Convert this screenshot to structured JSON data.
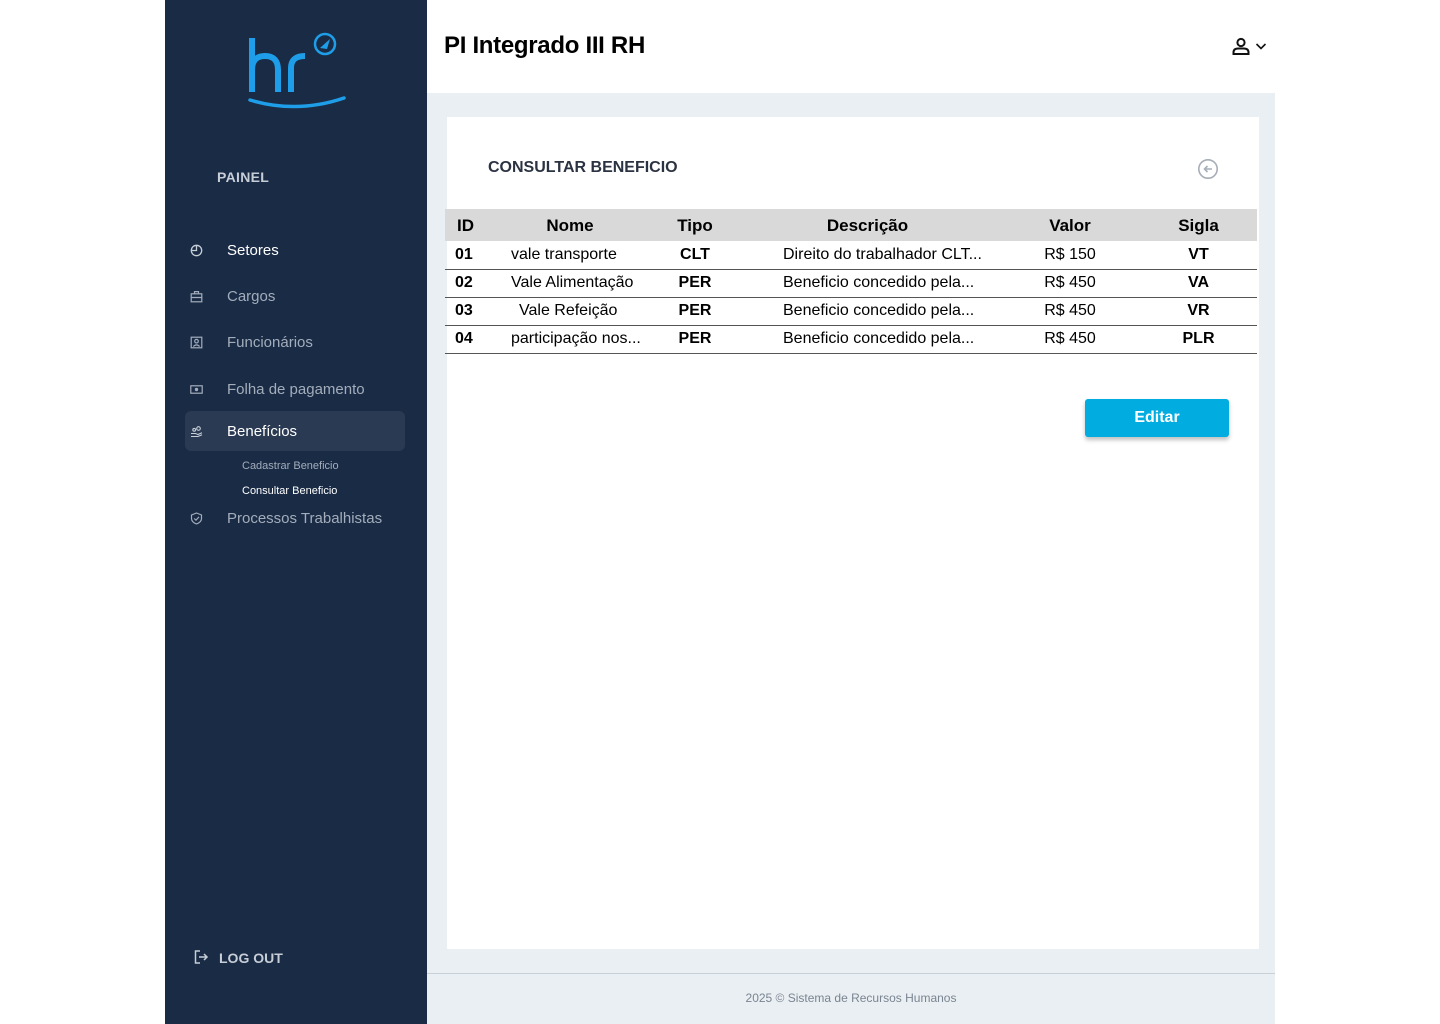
{
  "header": {
    "app_title": "PI Integrado III RH"
  },
  "sidebar": {
    "section_label": "PAINEL",
    "items": [
      {
        "label": "Setores",
        "icon": "pie-chart-icon"
      },
      {
        "label": "Cargos",
        "icon": "briefcase-icon"
      },
      {
        "label": "Funcionários",
        "icon": "id-badge-icon"
      },
      {
        "label": "Folha de pagamento",
        "icon": "money-icon"
      },
      {
        "label": "Benefícios",
        "icon": "hand-coins-icon"
      },
      {
        "label": "Processos Trabalhistas",
        "icon": "shield-check-icon"
      }
    ],
    "subitems": [
      {
        "label": "Cadastrar Beneficio"
      },
      {
        "label": "Consultar Beneficio"
      }
    ],
    "logout_label": "LOG OUT"
  },
  "page": {
    "title": "CONSULTAR BENEFICIO"
  },
  "table": {
    "headers": {
      "id": "ID",
      "nome": "Nome",
      "tipo": "Tipo",
      "descricao": "Descrição",
      "valor": "Valor",
      "sigla": "Sigla"
    },
    "rows": [
      {
        "id": "01",
        "nome": "vale transporte",
        "tipo": "CLT",
        "descricao": "Direito do trabalhador CLT...",
        "valor": "R$ 150",
        "sigla": "VT"
      },
      {
        "id": "02",
        "nome": "Vale Alimentação",
        "tipo": "PER",
        "descricao": "Beneficio concedido pela...",
        "valor": "R$ 450",
        "sigla": "VA"
      },
      {
        "id": "03",
        "nome": "Vale Refeição",
        "tipo": "PER",
        "descricao": "Beneficio concedido pela...",
        "valor": "R$ 450",
        "sigla": "VR"
      },
      {
        "id": "04",
        "nome": "participação nos...",
        "tipo": "PER",
        "descricao": "Beneficio concedido pela...",
        "valor": "R$ 450",
        "sigla": "PLR"
      }
    ]
  },
  "actions": {
    "edit_label": "Editar"
  },
  "footer": {
    "text": "2025 © Sistema de Recursos Humanos"
  },
  "colors": {
    "sidebar_bg": "#1a2b45",
    "accent": "#00ace0",
    "logo": "#1e9ee8",
    "content_bg": "#e9eff2"
  }
}
